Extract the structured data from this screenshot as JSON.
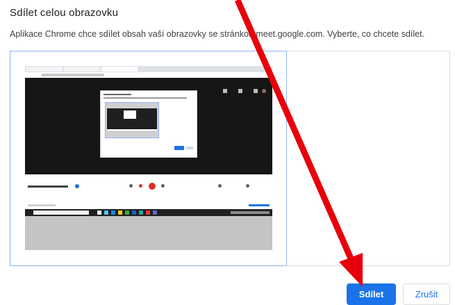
{
  "dialog": {
    "title": "Sdílet celou obrazovku",
    "description": "Aplikace Chrome chce sdílet obsah vaší obrazovky se stránkou meet.google.com. Vyberte, co chcete sdílet."
  },
  "buttons": {
    "share_label": "Sdílet",
    "cancel_label": "Zrušit"
  },
  "colors": {
    "accent": "#1a73e8",
    "selection_border": "#8ab4f8",
    "annotation_arrow": "#e8000b"
  },
  "icons": {
    "annotation": "red-arrow-icon"
  }
}
